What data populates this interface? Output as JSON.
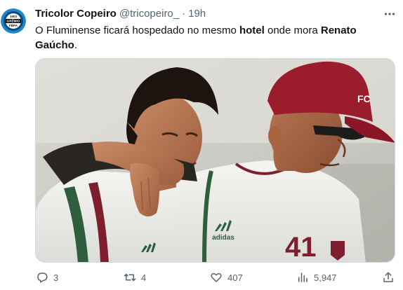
{
  "author": {
    "name": "Tricolor Copeiro",
    "handle": "@tricopeiro_",
    "separator": "·",
    "time": "19h",
    "avatar_icon": "gremio-crest-icon",
    "avatar_text_top": "1903",
    "avatar_text_mid": "GRÊMIO",
    "avatar_text_bot": "FBPA"
  },
  "tweet": {
    "text_part1": "O Fluminense ficará hospedado no mesmo ",
    "text_bold1": "hotel",
    "text_part2": " onde mora ",
    "text_bold2": "Renato Gaúcho",
    "text_part3": "."
  },
  "media": {
    "description_icon": "photo-icon",
    "shirt_brand": "adidas",
    "shirt_number": "41",
    "cap_letter": "FC"
  },
  "actions": {
    "reply_count": "3",
    "retweet_count": "4",
    "like_count": "407",
    "views_count": "5,947"
  },
  "colors": {
    "text": "#0f1419",
    "secondary": "#536471",
    "fluminense_maroon": "#7d1f2e",
    "fluminense_green": "#2e5e3e"
  }
}
